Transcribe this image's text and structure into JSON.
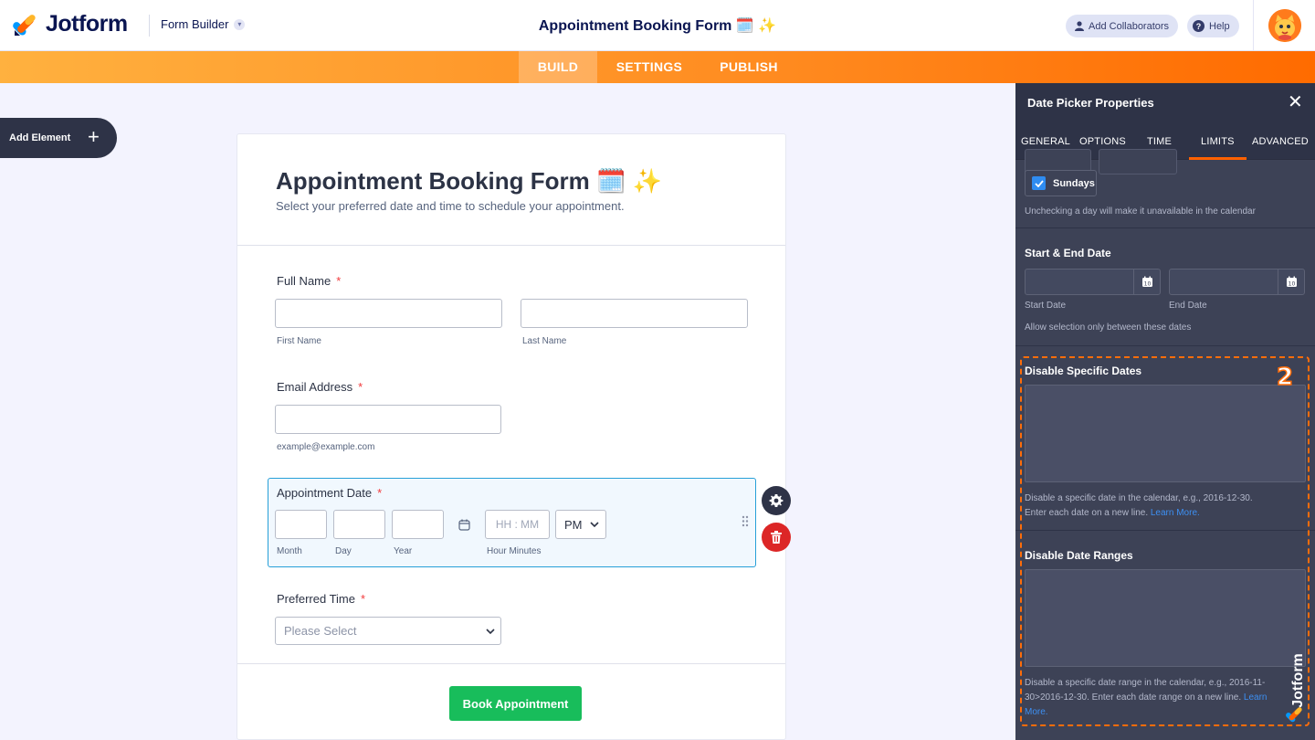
{
  "header": {
    "brand": "Jotform",
    "app_switcher": "Form Builder",
    "form_title": "Appointment Booking Form 🗓️ ✨",
    "collaborators_label": "Add Collaborators",
    "help_label": "Help"
  },
  "nav": {
    "tabs": [
      {
        "label": "BUILD",
        "active": true
      },
      {
        "label": "SETTINGS",
        "active": false
      },
      {
        "label": "PUBLISH",
        "active": false
      }
    ],
    "accent_start": "#ffb13f",
    "accent_end": "#ff6b00"
  },
  "add_element": {
    "label": "Add Element"
  },
  "form": {
    "heading": "Appointment Booking Form 🗓️ ✨",
    "subheading": "Select your preferred date and time to schedule your appointment.",
    "full_name": {
      "label": "Full Name",
      "required": "*",
      "first_sub": "First Name",
      "last_sub": "Last Name"
    },
    "email": {
      "label": "Email Address",
      "required": "*",
      "sub": "example@example.com"
    },
    "appointment_date": {
      "label": "Appointment Date",
      "required": "*",
      "month_sub": "Month",
      "day_sub": "Day",
      "year_sub": "Year",
      "time_placeholder": "HH : MM",
      "ampm": "PM",
      "time_sub": "Hour Minutes"
    },
    "preferred_time": {
      "label": "Preferred Time",
      "required": "*",
      "placeholder": "Please Select"
    },
    "submit_label": "Book Appointment"
  },
  "panel": {
    "title": "Date Picker Properties",
    "tabs": [
      {
        "label": "GENERAL",
        "active": false
      },
      {
        "label": "OPTIONS",
        "active": false
      },
      {
        "label": "TIME",
        "active": false
      },
      {
        "label": "LIMITS",
        "active": true
      },
      {
        "label": "ADVANCED",
        "active": false
      }
    ],
    "days": {
      "sundays_label": "Sundays",
      "sundays_checked": true,
      "note": "Unchecking a day will make it unavailable in the calendar"
    },
    "start_end": {
      "title": "Start & End Date",
      "start_sub": "Start Date",
      "end_sub": "End Date",
      "note": "Allow selection only between these dates",
      "calendar_day": "10"
    },
    "disable_dates": {
      "title": "Disable Specific Dates",
      "note_line1": "Disable a specific date in the calendar, e.g., 2016-12-30.",
      "note_line2": "Enter each date on a new line.",
      "learn_more": "Learn More."
    },
    "disable_ranges": {
      "title": "Disable Date Ranges",
      "note_line1": "Disable a specific date range in the calendar, e.g., 2016-11-",
      "note_line2": "30>2016-12-30. Enter each date range on a new line.",
      "learn_more_a": "Learn",
      "learn_more_b": "More."
    }
  },
  "annotation": {
    "step": "2",
    "color": "#ff6d0a"
  },
  "watermark": {
    "text": "Jotform"
  }
}
